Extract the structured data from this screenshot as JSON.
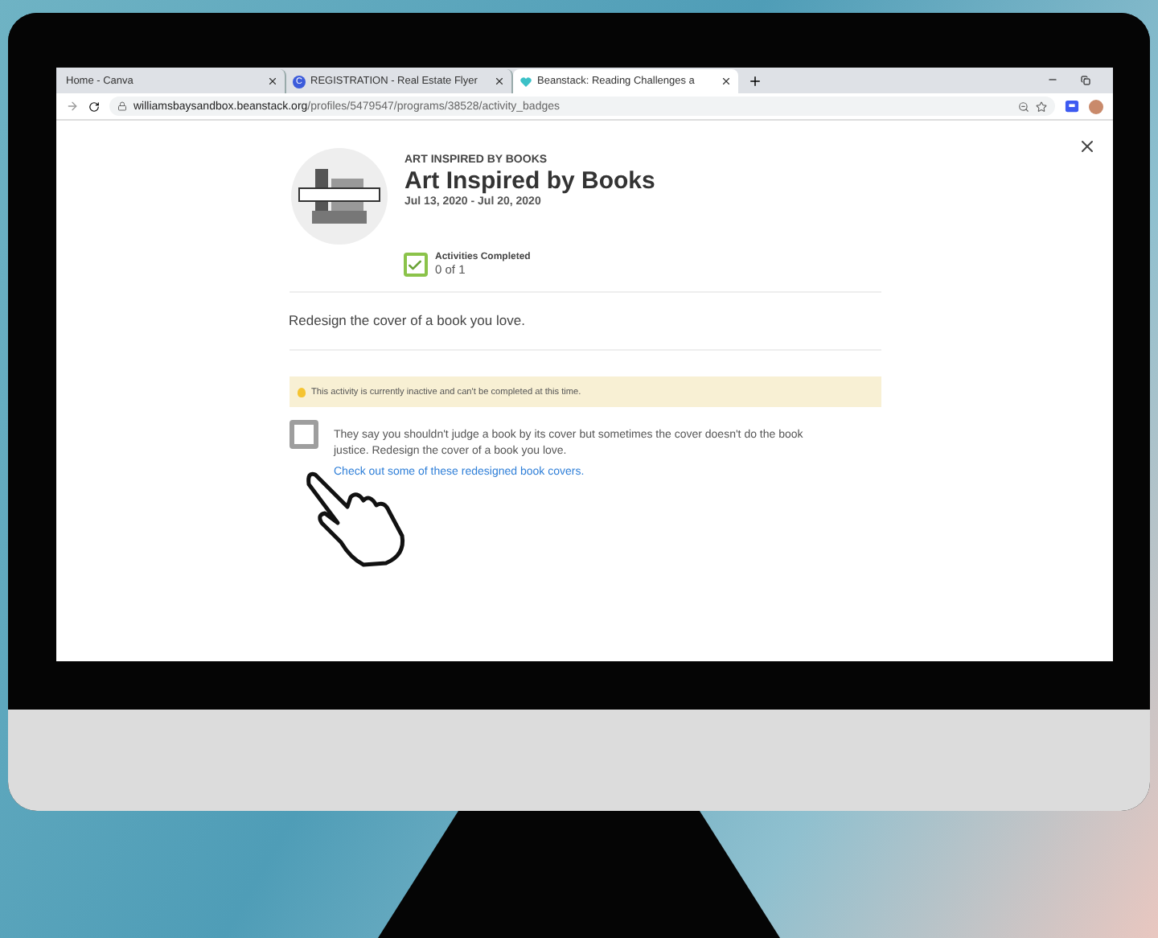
{
  "browser": {
    "tabs": [
      {
        "title": "Home - Canva",
        "selected": false
      },
      {
        "title": "REGISTRATION - Real Estate Flyer",
        "favicon_letter": "C",
        "selected": false
      },
      {
        "title": "Beanstack: Reading Challenges a",
        "selected": true
      }
    ],
    "url_host": "williamsbaysandbox.beanstack.org",
    "url_path": "/profiles/5479547/programs/38528/activity_badges"
  },
  "badge": {
    "overline": "ART INSPIRED BY BOOKS",
    "title": "Art Inspired by Books",
    "dates": "Jul 13, 2020 - Jul 20, 2020",
    "progress": {
      "label": "Activities Completed",
      "value": "0 of 1",
      "checked": true
    }
  },
  "description": "Redesign the cover of a book you love.",
  "notice": "This activity is currently inactive and can't be completed at this time.",
  "activity": {
    "checked": false,
    "text": "They say you shouldn't judge a book by its cover but sometimes the cover doesn't do the book justice. Redesign the cover of a book you love.",
    "link": "Check out some of these redesigned book covers."
  }
}
